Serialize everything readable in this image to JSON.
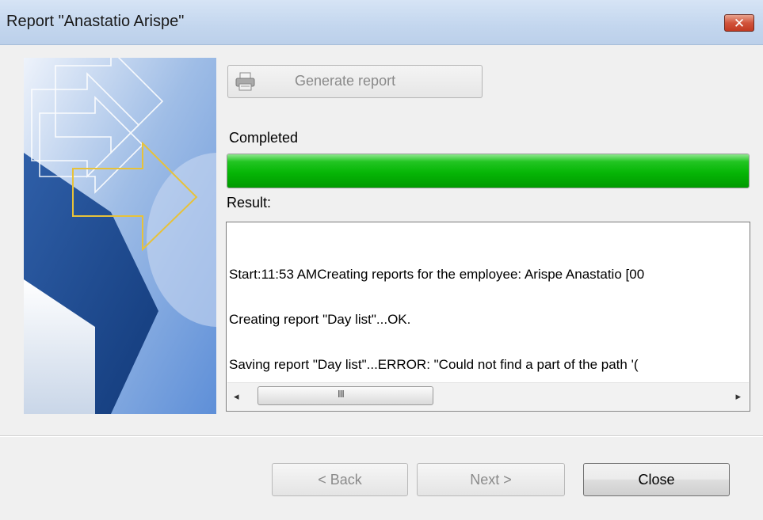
{
  "window": {
    "title": "Report \"Anastatio Arispe\"",
    "close_glyph": "✕"
  },
  "toolbar": {
    "generate_label": "Generate report",
    "generate_icon": "printer-icon"
  },
  "status": {
    "label": "Completed",
    "progress": 1.0,
    "progress_color": "#09b509"
  },
  "result": {
    "label": "Result:",
    "lines": [
      "Start:11:53 AMCreating reports for the employee: Arispe Anastatio [00",
      "Creating report \"Day list\"...OK.",
      "Saving report \"Day list\"...ERROR: \"Could not find a part of the path '("
    ],
    "scroll_left_glyph": "◂",
    "scroll_right_glyph": "▸",
    "scroll_grip": "III"
  },
  "footer": {
    "back_label": "< Back",
    "next_label": "Next >",
    "close_label": "Close"
  }
}
